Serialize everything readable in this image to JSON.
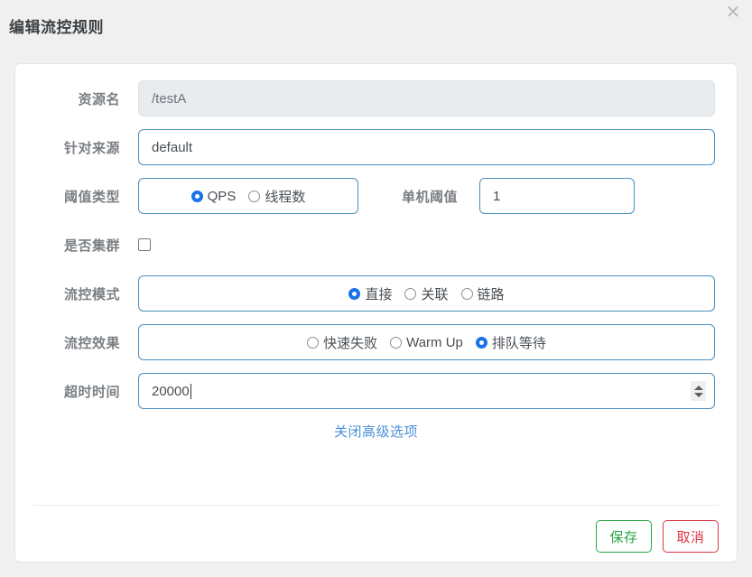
{
  "dialog": {
    "title": "编辑流控规则",
    "close_icon": "close-icon"
  },
  "form": {
    "resource": {
      "label": "资源名",
      "value": "/testA",
      "disabled": true
    },
    "origin": {
      "label": "针对来源",
      "value": "default"
    },
    "threshold_type": {
      "label": "阈值类型",
      "options": [
        {
          "label": "QPS",
          "selected": true
        },
        {
          "label": "线程数",
          "selected": false
        }
      ]
    },
    "single_threshold": {
      "label": "单机阈值",
      "value": "1"
    },
    "cluster": {
      "label": "是否集群",
      "checked": false
    },
    "flow_mode": {
      "label": "流控模式",
      "options": [
        {
          "label": "直接",
          "selected": true
        },
        {
          "label": "关联",
          "selected": false
        },
        {
          "label": "链路",
          "selected": false
        }
      ]
    },
    "flow_effect": {
      "label": "流控效果",
      "options": [
        {
          "label": "快速失败",
          "selected": false
        },
        {
          "label": "Warm Up",
          "selected": false
        },
        {
          "label": "排队等待",
          "selected": true
        }
      ]
    },
    "timeout": {
      "label": "超时时间",
      "value": "20000"
    },
    "advanced_link": "关闭高级选项"
  },
  "footer": {
    "save_label": "保存",
    "cancel_label": "取消"
  },
  "colors": {
    "accent_blue": "#1a73e8",
    "border_blue": "#4a8fc0",
    "link_blue": "#4a90d9",
    "save_green": "#28a745",
    "cancel_red": "#dc3545",
    "label_gray": "#7b7f84",
    "page_bg": "#f0f0f0"
  }
}
